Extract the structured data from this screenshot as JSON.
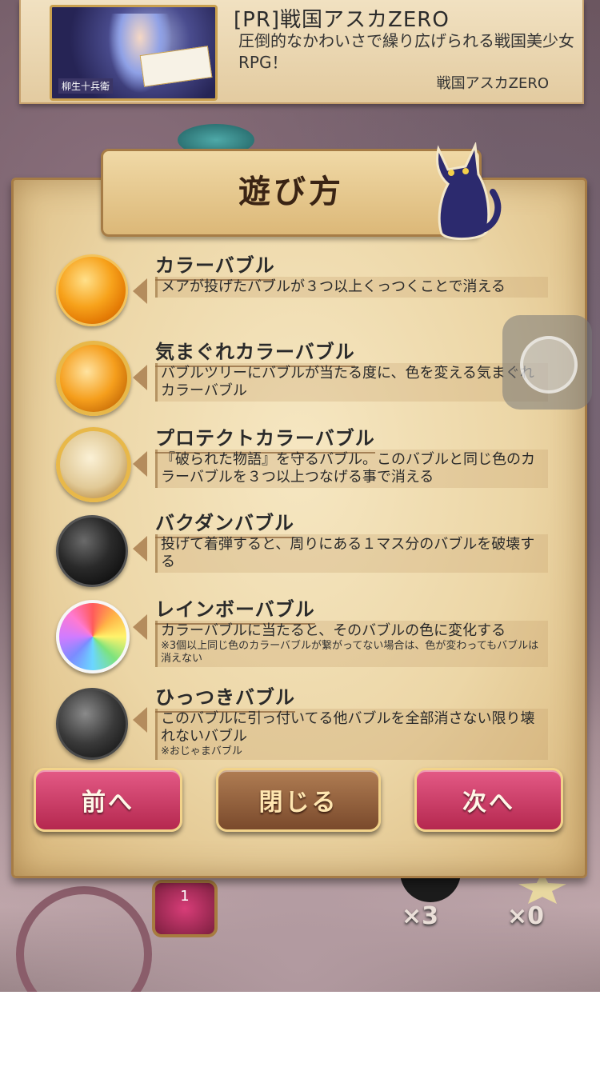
{
  "ad": {
    "title": "[PR]戦国アスカZERO",
    "description": "圧倒的なかわいさで繰り広げられる戦国美少女RPG！",
    "sponsor": "戦国アスカZERO",
    "thumb_caption": "柳生十兵衛"
  },
  "dialog": {
    "title": "遊び方"
  },
  "items": [
    {
      "icon": "orange-bubble-icon",
      "title": "カラーバブル",
      "description": "メアが投げたバブルが３つ以上くっつくことで消える",
      "note": ""
    },
    {
      "icon": "whimsical-bubble-icon",
      "title": "気まぐれカラーバブル",
      "description": "バブルツリーにバブルが当たる度に、色を変える気まぐれカラーバブル",
      "note": ""
    },
    {
      "icon": "protect-bubble-icon",
      "title": "プロテクトカラーバブル",
      "description": "『破られた物語』を守るバブル。このバブルと同じ色のカラーバブルを３つ以上つなげる事で消える",
      "note": ""
    },
    {
      "icon": "bomb-bubble-icon",
      "title": "バクダンバブル",
      "description": "投げて着弾すると、周りにある１マス分のバブルを破壊する",
      "note": ""
    },
    {
      "icon": "rainbow-bubble-icon",
      "title": "レインボーバブル",
      "description": "カラーバブルに当たると、そのバブルの色に変化する",
      "note": "※3個以上同じ色のカラーバブルが繋がってない場合は、色が変わってもバブルは消えない"
    },
    {
      "icon": "sticky-bubble-icon",
      "title": "ひっつきバブル",
      "description": "このバブルに引っ付いてる他バブルを全部消さない限り壊れないバブル",
      "note": "※おじゃまバブル"
    }
  ],
  "buttons": {
    "prev": "前へ",
    "close": "閉じる",
    "next": "次へ"
  },
  "game": {
    "counter": "1",
    "mult_left": "×3",
    "mult_right": "×0"
  }
}
